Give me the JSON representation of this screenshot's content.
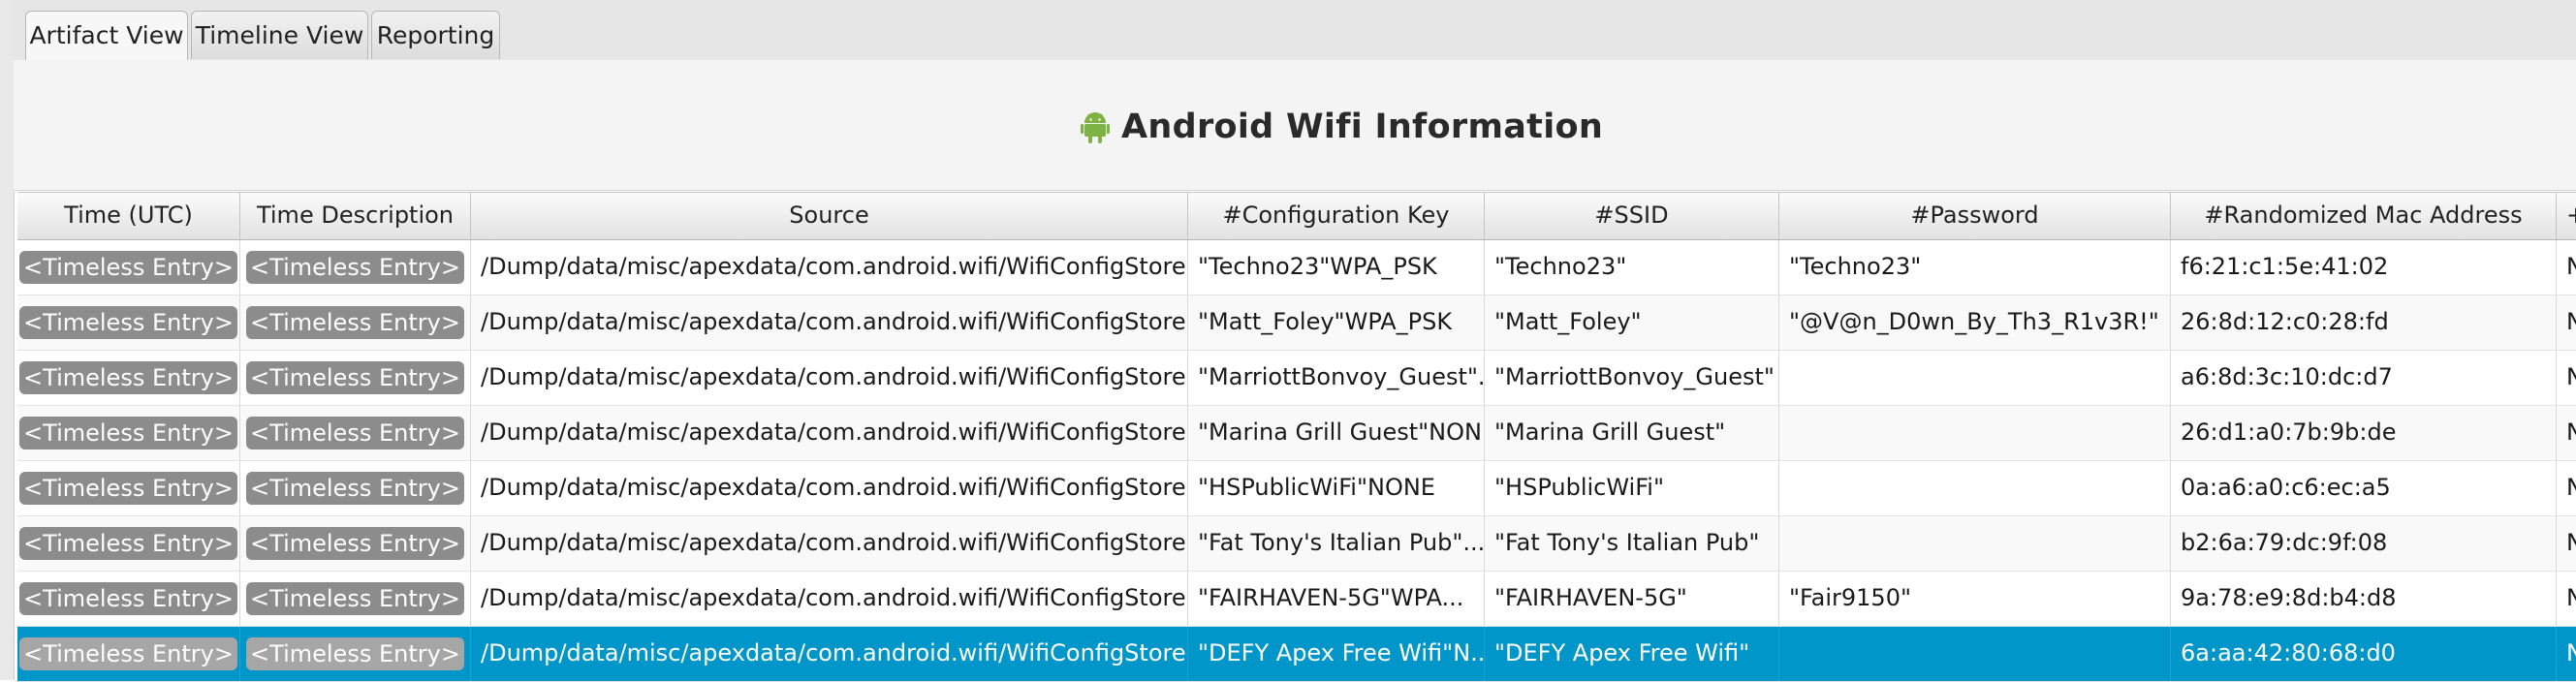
{
  "tabs": [
    {
      "label": "Artifact View",
      "active": true
    },
    {
      "label": "Timeline View",
      "active": false
    },
    {
      "label": "Reporting",
      "active": false
    }
  ],
  "report": {
    "title": "Android Wifi Information",
    "icon": "android-robot-icon",
    "accent_color": "#7cb342"
  },
  "table": {
    "columns": [
      "Time (UTC)",
      "Time Description",
      "Source",
      "#Configuration Key",
      "#SSID",
      "#Password",
      "#Randomized Mac Address",
      "+"
    ],
    "selected_color": "#0096c9",
    "rows": [
      {
        "time": "<Timeless Entry>",
        "desc": "<Timeless Entry>",
        "source": "/Dump/data/misc/apexdata/com.android.wifi/WifiConfigStore.xml",
        "key": "\"Techno23\"WPA_PSK",
        "ssid": "\"Techno23\"",
        "password": "\"Techno23\"",
        "mac": "f6:21:c1:5e:41:02",
        "extra": "N",
        "selected": false
      },
      {
        "time": "<Timeless Entry>",
        "desc": "<Timeless Entry>",
        "source": "/Dump/data/misc/apexdata/com.android.wifi/WifiConfigStore.xml",
        "key": "\"Matt_Foley\"WPA_PSK",
        "ssid": "\"Matt_Foley\"",
        "password": "\"@V@n_D0wn_By_Th3_R1v3R!\"",
        "mac": "26:8d:12:c0:28:fd",
        "extra": "N",
        "selected": false
      },
      {
        "time": "<Timeless Entry>",
        "desc": "<Timeless Entry>",
        "source": "/Dump/data/misc/apexdata/com.android.wifi/WifiConfigStore.xml",
        "key": "\"MarriottBonvoy_Guest\"...",
        "ssid": "\"MarriottBonvoy_Guest\"",
        "password": "",
        "mac": "a6:8d:3c:10:dc:d7",
        "extra": "N",
        "selected": false
      },
      {
        "time": "<Timeless Entry>",
        "desc": "<Timeless Entry>",
        "source": "/Dump/data/misc/apexdata/com.android.wifi/WifiConfigStore.xml",
        "key": "\"Marina Grill Guest\"NONE",
        "ssid": "\"Marina Grill Guest\"",
        "password": "",
        "mac": "26:d1:a0:7b:9b:de",
        "extra": "N",
        "selected": false
      },
      {
        "time": "<Timeless Entry>",
        "desc": "<Timeless Entry>",
        "source": "/Dump/data/misc/apexdata/com.android.wifi/WifiConfigStore.xml",
        "key": "\"HSPublicWiFi\"NONE",
        "ssid": "\"HSPublicWiFi\"",
        "password": "",
        "mac": "0a:a6:a0:c6:ec:a5",
        "extra": "N",
        "selected": false
      },
      {
        "time": "<Timeless Entry>",
        "desc": "<Timeless Entry>",
        "source": "/Dump/data/misc/apexdata/com.android.wifi/WifiConfigStore.xml",
        "key": "\"Fat Tony's Italian Pub\"...",
        "ssid": "\"Fat Tony's Italian Pub\"",
        "password": "",
        "mac": "b2:6a:79:dc:9f:08",
        "extra": "N",
        "selected": false
      },
      {
        "time": "<Timeless Entry>",
        "desc": "<Timeless Entry>",
        "source": "/Dump/data/misc/apexdata/com.android.wifi/WifiConfigStore.xml",
        "key": "\"FAIRHAVEN-5G\"WPA...",
        "ssid": "\"FAIRHAVEN-5G\"",
        "password": "\"Fair9150\"",
        "mac": "9a:78:e9:8d:b4:d8",
        "extra": "N",
        "selected": false
      },
      {
        "time": "<Timeless Entry>",
        "desc": "<Timeless Entry>",
        "source": "/Dump/data/misc/apexdata/com.android.wifi/WifiConfigStore.xml",
        "key": "\"DEFY Apex Free Wifi\"N...",
        "ssid": "\"DEFY Apex Free Wifi\"",
        "password": "",
        "mac": "6a:aa:42:80:68:d0",
        "extra": "N",
        "selected": true
      }
    ]
  }
}
